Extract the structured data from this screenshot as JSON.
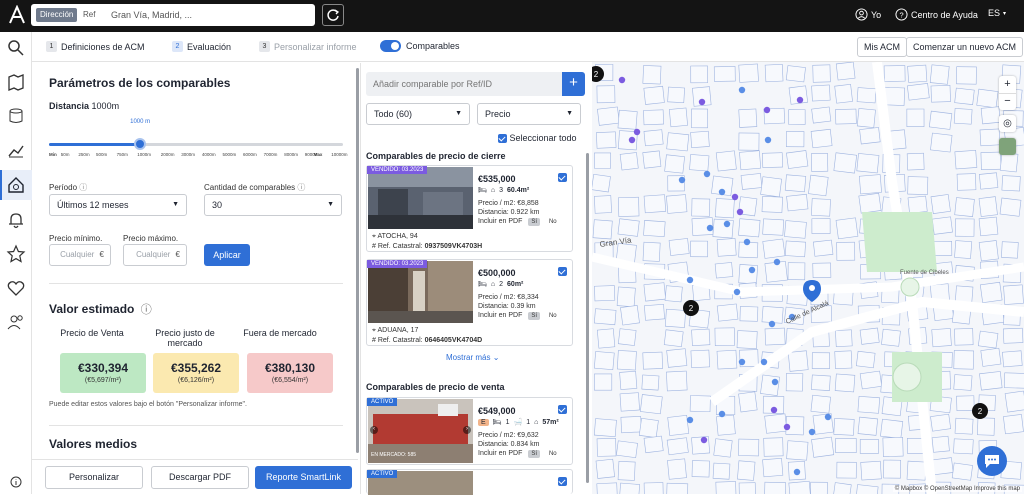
{
  "topbar": {
    "search": {
      "tag_direccion": "Dirección",
      "tag_ref": "Ref",
      "value": "Gran Vía, Madrid, ..."
    },
    "user_label": "Yo",
    "help_label": "Centro de Ayuda",
    "language": "ES"
  },
  "steps": [
    {
      "num": "1",
      "label": "Definiciones de ACM"
    },
    {
      "num": "2",
      "label": "Evaluación"
    },
    {
      "num": "3",
      "label": "Personalizar informe"
    }
  ],
  "subbar": {
    "toggle_label": "Comparables",
    "my_acm": "Mis ACM",
    "new_acm": "Comenzar un nuevo ACM"
  },
  "params": {
    "title": "Parámetros de los comparables",
    "distance_label": "Distancia",
    "distance_value": "1000m",
    "slider_bubble": "1000 m",
    "slider_fraction": 0.31,
    "ticks": [
      "Min",
      "50m",
      "250m",
      "500m",
      "750m",
      "1000m",
      "2000m",
      "3000m",
      "4000m",
      "5000m",
      "6000m",
      "7000m",
      "8000m",
      "9000m",
      "Max",
      "10000m"
    ],
    "period_label": "Período",
    "period_value": "Últimos 12 meses",
    "count_label": "Cantidad de comparables",
    "count_value": "30",
    "min_price_label": "Precio mínimo.",
    "max_price_label": "Precio máximo.",
    "min_placeholder": "Cualquier",
    "max_placeholder": "Cualquier",
    "currency": "€",
    "apply": "Aplicar"
  },
  "valuation": {
    "title": "Valor estimado",
    "columns": [
      {
        "header": "Precio de Venta",
        "value": "€330,394",
        "sub": "(€5,697/m²)",
        "color": "#bde8c3"
      },
      {
        "header": "Precio justo de mercado",
        "value": "€355,262",
        "sub": "(€6,126/m²)",
        "color": "#fbe9b0"
      },
      {
        "header": "Fuera de mercado",
        "value": "€380,130",
        "sub": "(€6,554/m²)",
        "color": "#f6c9c9"
      }
    ],
    "note": "Puede editar estos valores bajo el botón \"Personalizar informe\".",
    "averages_title": "Valores medios"
  },
  "footer": {
    "customize": "Personalizar",
    "download": "Descargar PDF",
    "smartlink": "Reporte SmartLink"
  },
  "comparables": {
    "add_placeholder": "Añadir comparable por Ref/ID",
    "filter_value": "Todo (60)",
    "sort_value": "Precio",
    "select_all": "Seleccionar todo",
    "closing_title": "Comparables de precio de cierre",
    "sale_title": "Comparables de precio de venta",
    "show_more": "Mostrar más",
    "cards": [
      {
        "badge": "VENDIDO: 03.2023",
        "price": "€535,000",
        "beds": "3",
        "area": "60.4m²",
        "ppm": "Precio / m2: €8,858",
        "dist": "Distancia: 0.922 km",
        "pdf": "Incluir en PDF",
        "yes": "Sí",
        "no": "No",
        "addr": "ATOCHA, 94",
        "cadastral": "Ref. Catastral:",
        "cad_value": "0937509VK4703H"
      },
      {
        "badge": "VENDIDO: 03.2023",
        "price": "€500,000",
        "beds": "2",
        "area": "60m²",
        "ppm": "Precio / m2: €8,334",
        "dist": "Distancia: 0.39 km",
        "pdf": "Incluir en PDF",
        "yes": "Sí",
        "no": "No",
        "addr": "ADUANA, 17",
        "cadastral": "Ref. Catastral:",
        "cad_value": "0646405VK4704D"
      },
      {
        "badge": "ACTIVO",
        "price": "€549,000",
        "energy": "E",
        "beds": "1",
        "baths": "1",
        "area": "57m²",
        "ppm": "Precio / m2: €9,632",
        "dist": "Distancia: 0.834 km",
        "pdf": "Incluir en PDF",
        "yes": "Sí",
        "no": "No",
        "on_market": "EN MERCADO: 585"
      },
      {
        "badge": "ACTIVO"
      }
    ]
  },
  "map": {
    "streets": [
      "Gran Vía",
      "Calle de Alcalá"
    ],
    "places": [
      "Fuente de Cibeles"
    ],
    "clusters": [
      "2",
      "2",
      "2"
    ],
    "attribution": "© Mapbox © OpenStreetMap Improve this map",
    "zoom_in": "+",
    "zoom_out": "−"
  }
}
